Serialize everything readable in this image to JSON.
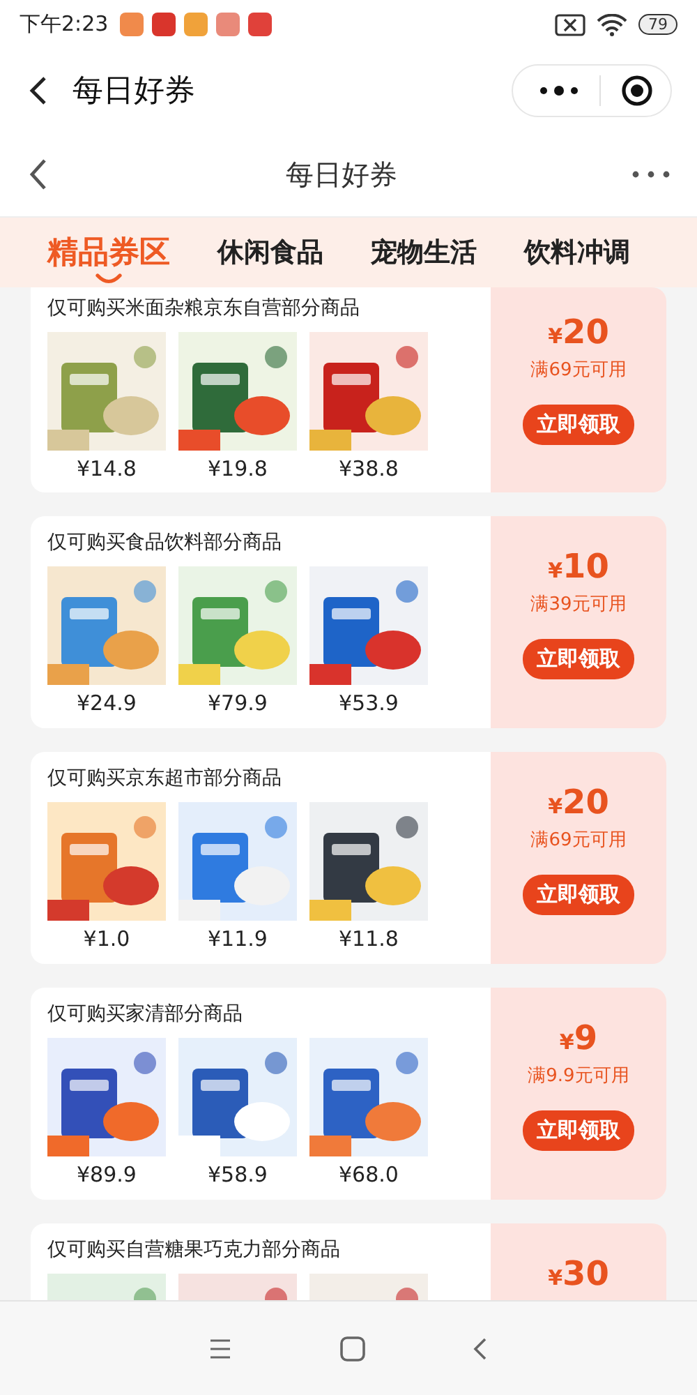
{
  "status_bar": {
    "time": "下午2:23",
    "battery": "79"
  },
  "mini_program_bar": {
    "title": "每日好券"
  },
  "header": {
    "title": "每日好券"
  },
  "tabs": [
    {
      "label": "精品券区",
      "selected": true
    },
    {
      "label": "休闲食品",
      "selected": false
    },
    {
      "label": "宠物生活",
      "selected": false
    },
    {
      "label": "饮料冲调",
      "selected": false
    }
  ],
  "coupons": [
    {
      "title": "仅可购买米面杂粮京东自营部分商品",
      "currency": "¥",
      "amount": "20",
      "condition": "满69元可用",
      "button": "立即领取",
      "products": [
        {
          "price": "¥14.8"
        },
        {
          "price": "¥19.8"
        },
        {
          "price": "¥38.8"
        }
      ]
    },
    {
      "title": "仅可购买食品饮料部分商品",
      "currency": "¥",
      "amount": "10",
      "condition": "满39元可用",
      "button": "立即领取",
      "products": [
        {
          "price": "¥24.9"
        },
        {
          "price": "¥79.9"
        },
        {
          "price": "¥53.9"
        }
      ]
    },
    {
      "title": "仅可购买京东超市部分商品",
      "currency": "¥",
      "amount": "20",
      "condition": "满69元可用",
      "button": "立即领取",
      "products": [
        {
          "price": "¥1.0"
        },
        {
          "price": "¥11.9"
        },
        {
          "price": "¥11.8"
        }
      ]
    },
    {
      "title": "仅可购买家清部分商品",
      "currency": "¥",
      "amount": "9",
      "condition": "满9.9元可用",
      "button": "立即领取",
      "products": [
        {
          "price": "¥89.9"
        },
        {
          "price": "¥58.9"
        },
        {
          "price": "¥68.0"
        }
      ]
    },
    {
      "title": "仅可购买自营糖果巧克力部分商品",
      "currency": "¥",
      "amount": "30"
    }
  ]
}
